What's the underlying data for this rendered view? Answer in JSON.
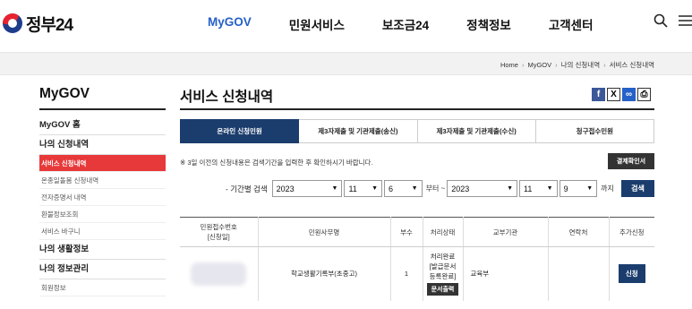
{
  "header": {
    "logo_text": "정부24",
    "nav": [
      "MyGOV",
      "민원서비스",
      "보조금24",
      "정책정보",
      "고객센터"
    ],
    "active_nav": "MyGOV"
  },
  "breadcrumb": [
    "Home",
    "MyGOV",
    "나의 신청내역",
    "서비스 신청내역"
  ],
  "sidebar": {
    "title": "MyGOV",
    "home": "MyGOV 홈",
    "section1": "나의 신청내역",
    "sub": [
      "서비스 신청내역",
      "온종일돌봄 신청내역",
      "전자증명서 내역",
      "환불정보조회",
      "서비스 바구니"
    ],
    "section2": "나의 생활정보",
    "section3": "나의 정보관리",
    "sub3": [
      "회원정보"
    ]
  },
  "main": {
    "title": "서비스 신청내역",
    "tabs": [
      "온라인 신청민원",
      "제3자제출 및 기관제출(송신)",
      "제3자제출 및 기관제출(수신)",
      "청구접수민원"
    ],
    "notice": "※ 3일 이전의 신청내용은 검색기간을 입력한 후 확인하시기 바랍니다.",
    "cert_button": "결제확인서",
    "search": {
      "label": "- 기간별 검색",
      "from_year": "2023",
      "from_month": "11",
      "from_day": "6",
      "from_suffix": "부터 ~",
      "to_year": "2023",
      "to_month": "11",
      "to_day": "9",
      "to_suffix": "까지",
      "button": "검색"
    },
    "table": {
      "headers": [
        "민원접수번호\n[신청일]",
        "민원사무명",
        "부수",
        "처리상태",
        "교부기관",
        "연락처",
        "추가신청"
      ],
      "rows": [
        {
          "case_name": "학교생활기록부(초중고)",
          "copies": "1",
          "status": [
            "처리완료",
            "[발급문서",
            "등록완료]"
          ],
          "doc_button": "문서출력",
          "agency": "교육부",
          "contact": "",
          "apply_button": "신청"
        }
      ]
    }
  }
}
